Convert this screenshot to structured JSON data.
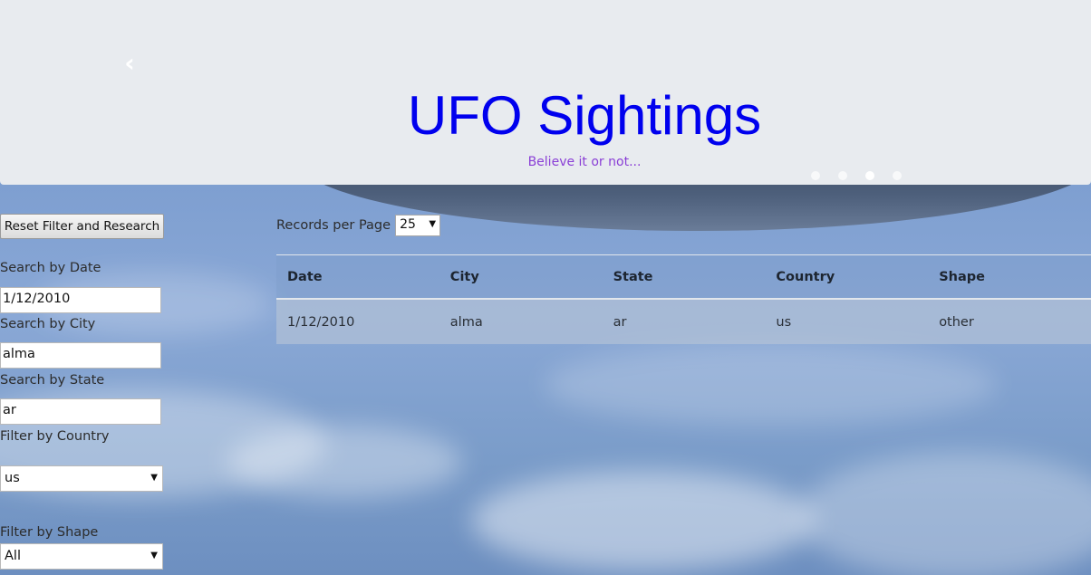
{
  "header": {
    "title": "UFO Sightings",
    "subtitle": "Believe it or not...",
    "prev_icon": "chevron-left-icon",
    "carousel_dots": 4,
    "active_dot": 2
  },
  "sidebar": {
    "reset_label": "Reset Filter and Research",
    "date_label": "Search by Date",
    "date_value": "1/12/2010",
    "city_label": "Search by City",
    "city_value": "alma",
    "state_label": "Search by State",
    "state_value": "ar",
    "country_label": "Filter by Country",
    "country_value": "us",
    "shape_label": "Filter by Shape",
    "shape_value": "All"
  },
  "pagination": {
    "records_label": "Records per Page",
    "records_value": "25"
  },
  "table": {
    "columns": [
      "Date",
      "City",
      "State",
      "Country",
      "Shape"
    ],
    "rows": [
      [
        "1/12/2010",
        "alma",
        "ar",
        "us",
        "other"
      ]
    ]
  },
  "colors": {
    "title": "#0000ee",
    "subtitle": "#8a3fd6",
    "header_bg": "#e8ebef"
  }
}
